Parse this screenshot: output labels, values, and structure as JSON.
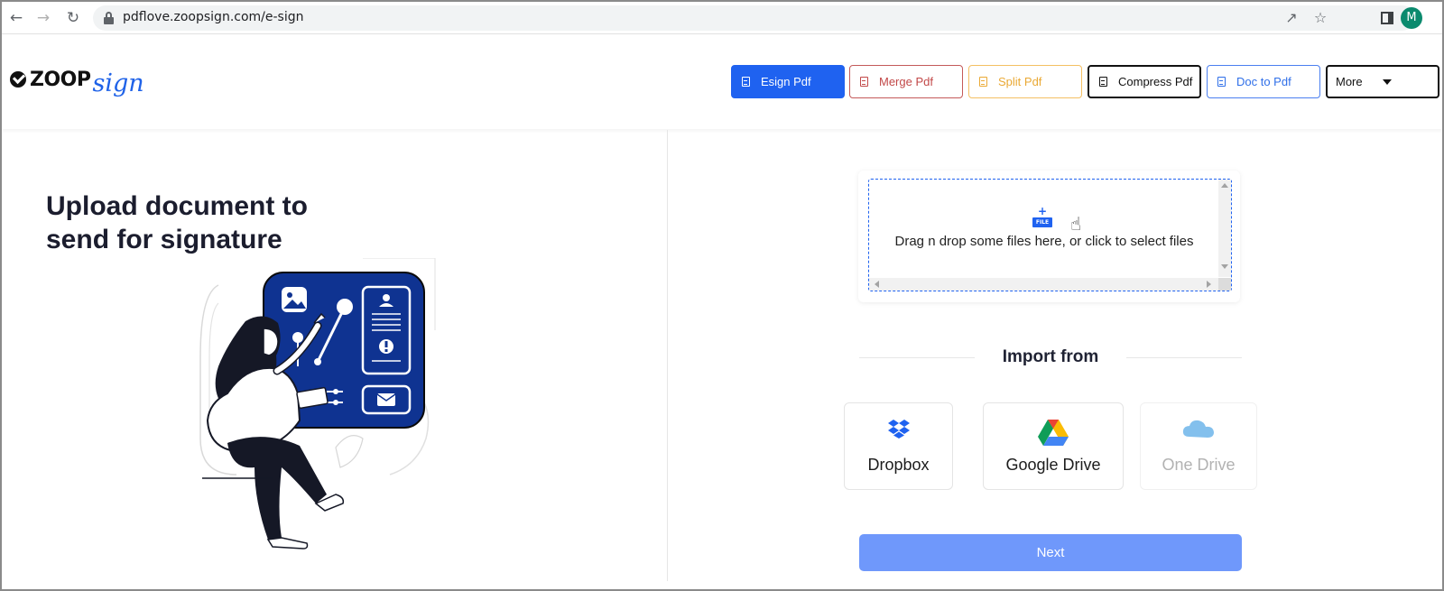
{
  "browser": {
    "url": "pdflove.zoopsign.com/e-sign",
    "profile_initial": "M"
  },
  "header": {
    "logo_word": "ZOOP",
    "logo_script": "sign",
    "tools": [
      {
        "label": "Esign Pdf",
        "active": true
      },
      {
        "label": "Merge Pdf"
      },
      {
        "label": "Split Pdf"
      },
      {
        "label": "Compress Pdf"
      },
      {
        "label": "Doc to Pdf"
      },
      {
        "label": "More"
      }
    ]
  },
  "left": {
    "headline_line1": "Upload document to",
    "headline_line2": "send for signature"
  },
  "dropzone": {
    "file_icon_tag": "FILE",
    "text": "Drag n drop some files here, or click to select files"
  },
  "import": {
    "title": "Import from",
    "sources": [
      {
        "label": "Dropbox",
        "icon": "dropbox-icon",
        "enabled": true
      },
      {
        "label": "Google Drive",
        "icon": "google-drive-icon",
        "enabled": true
      },
      {
        "label": "One Drive",
        "icon": "onedrive-icon",
        "enabled": false
      }
    ]
  },
  "actions": {
    "next_label": "Next"
  },
  "colors": {
    "primary": "#1f62f0",
    "next_button": "#6f98fb",
    "illustration_panel": "#0f3391"
  }
}
